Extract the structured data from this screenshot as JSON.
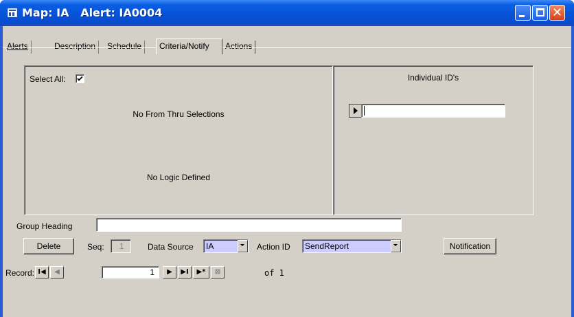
{
  "window": {
    "title": "Map: IA   Alert: IA0004",
    "controls": [
      "minimize-icon",
      "maximize-icon",
      "close-icon"
    ]
  },
  "tabs": [
    {
      "label": "Alerts"
    },
    {
      "label": "Description"
    },
    {
      "label": "Schedule"
    },
    {
      "label": "Criteria/Notify",
      "active": true
    },
    {
      "label": "Actions"
    }
  ],
  "criteria": {
    "select_all_label": "Select All:",
    "select_all_checked": true,
    "from_thru_text": "No From Thru Selections",
    "logic_text": "No Logic Defined"
  },
  "individual_ids": {
    "heading": "Individual ID's",
    "row_value": ""
  },
  "form": {
    "group_heading_label": "Group Heading",
    "group_heading_value": "",
    "delete_label": "Delete",
    "seq_label": "Seq:",
    "seq_value": "1",
    "data_source_label": "Data Source",
    "data_source_value": "IA",
    "action_id_label": "Action ID",
    "action_id_value": "SendReport",
    "notification_label": "Notification"
  },
  "record_nav": {
    "label": "Record:",
    "current": "1",
    "of_text": "of 1"
  },
  "colors": {
    "titlebar": "#0653d8",
    "client_bg": "#d4d0c8",
    "action_id_bg": "#ccccff"
  }
}
